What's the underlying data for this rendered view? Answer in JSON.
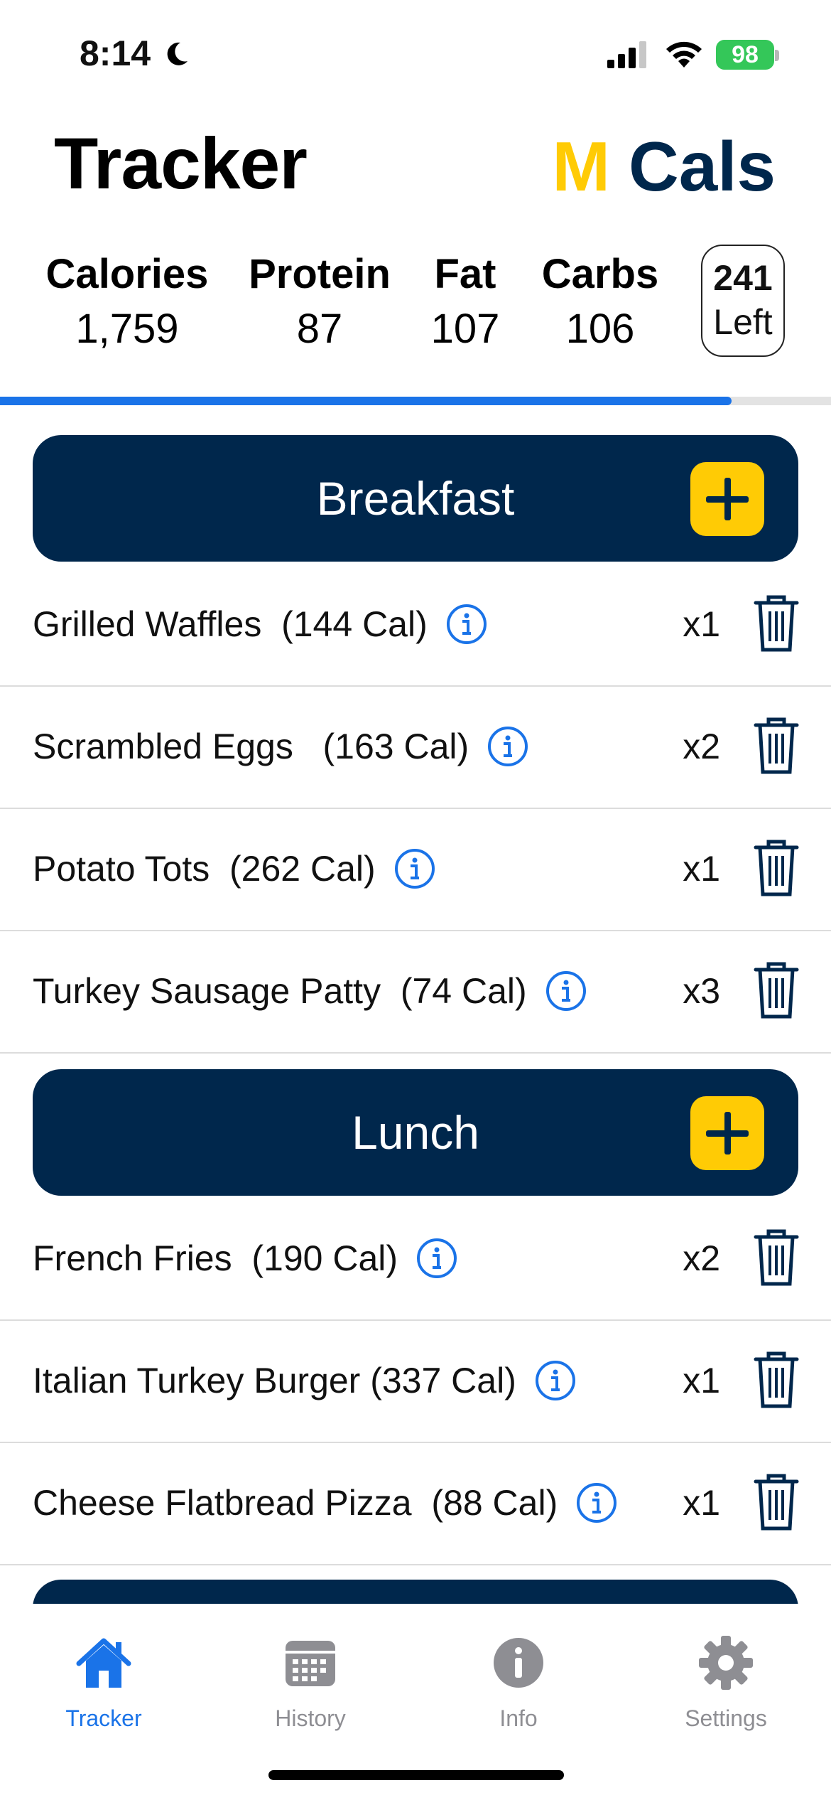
{
  "status_bar": {
    "time": "8:14",
    "battery": "98"
  },
  "header": {
    "title": "Tracker",
    "brand_m": "M",
    "brand_cals": "Cals"
  },
  "stats": [
    {
      "label": "Calories",
      "value": "1,759"
    },
    {
      "label": "Protein",
      "value": "87"
    },
    {
      "label": "Fat",
      "value": "107"
    },
    {
      "label": "Carbs",
      "value": "106"
    }
  ],
  "remaining": {
    "value": "241",
    "label": "Left"
  },
  "progress_fraction": 0.88,
  "meals": [
    {
      "name": "Breakfast",
      "items": [
        {
          "food": "Grilled Waffles  (144 Cal)",
          "qty": "x1"
        },
        {
          "food": "Scrambled Eggs   (163 Cal)",
          "qty": "x2"
        },
        {
          "food": "Potato Tots  (262 Cal)",
          "qty": "x1"
        },
        {
          "food": "Turkey Sausage Patty  (74 Cal)",
          "qty": "x3"
        }
      ]
    },
    {
      "name": "Lunch",
      "items": [
        {
          "food": "French Fries  (190 Cal)",
          "qty": "x2"
        },
        {
          "food": "Italian Turkey Burger (337 Cal)",
          "qty": "x1"
        },
        {
          "food": "Cheese Flatbread Pizza  (88 Cal)",
          "qty": "x1"
        }
      ]
    }
  ],
  "tabs": [
    {
      "label": "Tracker",
      "icon": "house-icon",
      "active": true
    },
    {
      "label": "History",
      "icon": "calendar-icon",
      "active": false
    },
    {
      "label": "Info",
      "icon": "info-icon",
      "active": false
    },
    {
      "label": "Settings",
      "icon": "gear-icon",
      "active": false
    }
  ],
  "colors": {
    "navy": "#00274c",
    "maize": "#ffcb05",
    "accent_blue": "#1a73e8",
    "battery_green": "#34c759",
    "tab_inactive": "#8e8e93"
  }
}
